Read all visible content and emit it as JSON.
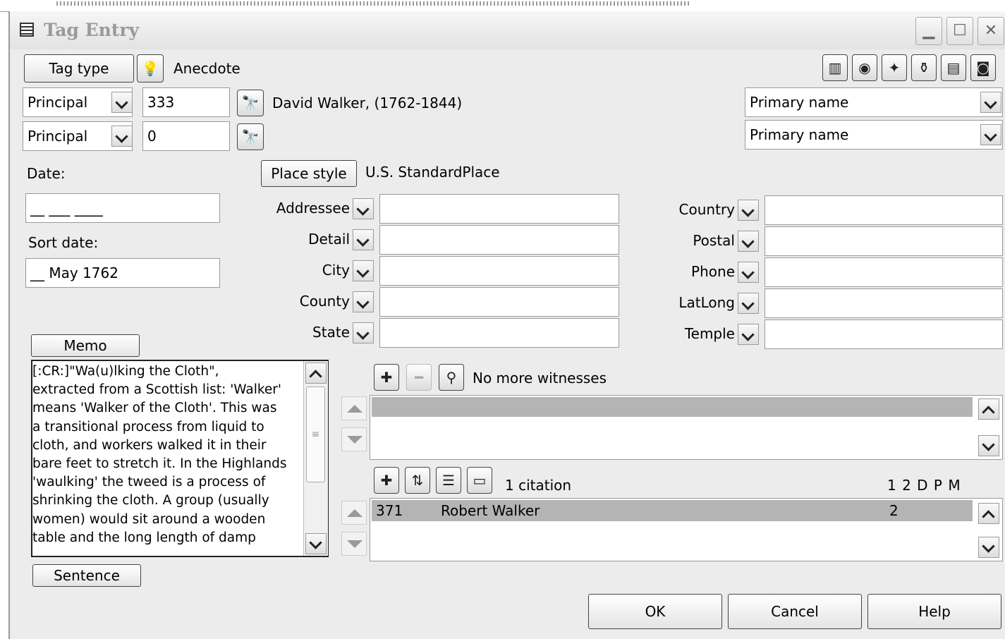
{
  "window": {
    "title": "Tag Entry"
  },
  "tag": {
    "button": "Tag type",
    "type_value": "Anecdote"
  },
  "principals": [
    {
      "role": "Principal",
      "id": "333",
      "name": "David Walker, (1762-1844)",
      "name_type": "Primary name"
    },
    {
      "role": "Principal",
      "id": "0",
      "name": "",
      "name_type": "Primary name"
    }
  ],
  "date": {
    "label": "Date:",
    "value": "__ ___ ____",
    "sort_label": "Sort date:",
    "sort_value": "__ May 1762"
  },
  "place": {
    "button": "Place style",
    "style_value": "U.S. StandardPlace",
    "left_fields": [
      {
        "label": "Addressee",
        "value": ""
      },
      {
        "label": "Detail",
        "value": ""
      },
      {
        "label": "City",
        "value": ""
      },
      {
        "label": "County",
        "value": ""
      },
      {
        "label": "State",
        "value": ""
      }
    ],
    "right_fields": [
      {
        "label": "Country",
        "value": ""
      },
      {
        "label": "Postal",
        "value": ""
      },
      {
        "label": "Phone",
        "value": ""
      },
      {
        "label": "LatLong",
        "value": ""
      },
      {
        "label": "Temple",
        "value": ""
      }
    ]
  },
  "memo": {
    "button": "Memo",
    "lines": [
      "[:CR:]\"Wa(u)lking the Cloth\",",
      "extracted from a Scottish list: 'Walker'",
      "means 'Walker of the Cloth'.  This was",
      "a transitional process from liquid to",
      "cloth, and workers walked it in their",
      "bare feet to stretch it. In the Highlands",
      "'waulking' the tweed is a process of",
      "shrinking the cloth.  A group (usually",
      "women) would sit around a wooden",
      "table and the long length of damp"
    ],
    "sentence_button": "Sentence"
  },
  "witnesses": {
    "status": "No more witnesses"
  },
  "citations": {
    "count_label": "1  citation",
    "header": "1 2 D P M",
    "rows": [
      {
        "id": "371",
        "name": "Robert Walker",
        "quality": "2"
      }
    ]
  },
  "footer": {
    "ok": "OK",
    "cancel": "Cancel",
    "help": "Help"
  }
}
